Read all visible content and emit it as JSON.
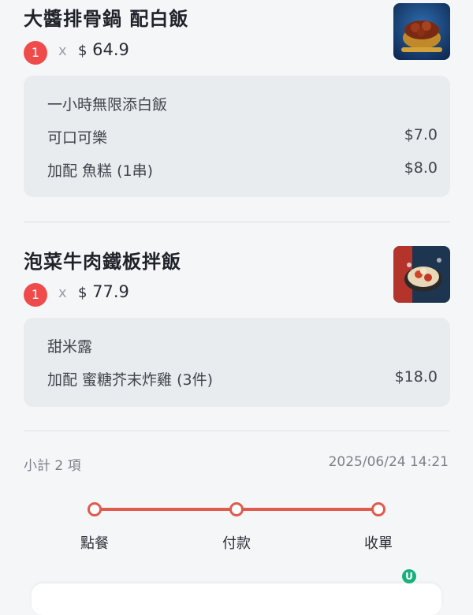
{
  "items": [
    {
      "name": "大醬排骨鍋 配白飯",
      "quantity": "1",
      "times": "x",
      "currency": "$",
      "price": "64.9",
      "options": [
        {
          "label": "一小時無限添白飯",
          "price": ""
        },
        {
          "label": "可口可樂",
          "price": "$7.0"
        },
        {
          "label": "加配 魚糕 (1串)",
          "price": "$8.0"
        }
      ]
    },
    {
      "name": "泡菜牛肉鐵板拌飯",
      "quantity": "1",
      "times": "x",
      "currency": "$",
      "price": "77.9",
      "options": [
        {
          "label": "甜米露",
          "price": ""
        },
        {
          "label": "加配 蜜糖芥末炸雞 (3件)",
          "price": "$18.0"
        }
      ]
    }
  ],
  "summary": {
    "subtotal": "小計 2 項",
    "datetime": "2025/06/24 14:21"
  },
  "progress": {
    "steps": [
      "點餐",
      "付款",
      "收單"
    ],
    "completed": 3
  },
  "watermark": {
    "logo": "U"
  },
  "colors": {
    "accent": "#e05a4e",
    "badge": "#ef4b4b",
    "card": "#e9ecef",
    "background": "#f5f6f8"
  }
}
